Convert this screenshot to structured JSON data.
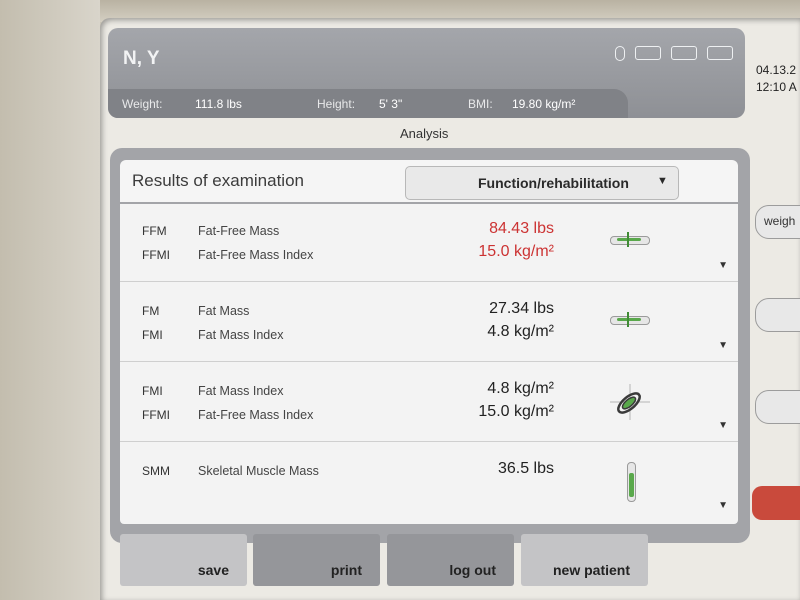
{
  "patient": {
    "name": "N, Y",
    "weight_label": "Weight:",
    "weight": "111.8 lbs",
    "height_label": "Height:",
    "height": "5' 3\"",
    "bmi_label": "BMI:",
    "bmi": "19.80 kg/m²"
  },
  "datetime": {
    "date": "04.13.2",
    "time": "12:10 A"
  },
  "tab_title": "Analysis",
  "panel": {
    "title": "Results of examination",
    "dropdown_selected": "Function/rehabilitation"
  },
  "results": [
    {
      "lines": [
        {
          "abbr": "FFM",
          "name": "Fat-Free Mass",
          "value": "84.43 lbs",
          "highlight": true
        },
        {
          "abbr": "FFMI",
          "name": "Fat-Free Mass Index",
          "value": "15.0 kg/m²",
          "highlight": true
        }
      ],
      "indicator": "horizontal-gauge-icon"
    },
    {
      "lines": [
        {
          "abbr": "FM",
          "name": "Fat Mass",
          "value": "27.34 lbs",
          "highlight": false
        },
        {
          "abbr": "FMI",
          "name": "Fat Mass Index",
          "value": "4.8 kg/m²",
          "highlight": false
        }
      ],
      "indicator": "horizontal-gauge-icon"
    },
    {
      "lines": [
        {
          "abbr": "FMI",
          "name": "Fat Mass Index",
          "value": "4.8 kg/m²",
          "highlight": false
        },
        {
          "abbr": "FFMI",
          "name": "Fat-Free Mass Index",
          "value": "15.0 kg/m²",
          "highlight": false
        }
      ],
      "indicator": "target-ellipse-icon"
    },
    {
      "lines": [
        {
          "abbr": "SMM",
          "name": "Skeletal Muscle Mass",
          "value": "36.5 lbs",
          "highlight": false
        }
      ],
      "indicator": "vertical-gauge-icon"
    }
  ],
  "buttons": {
    "save": "save",
    "print": "print",
    "logout": "log out",
    "new_patient": "new patient"
  },
  "side": {
    "weight_button": "weigh"
  },
  "colors": {
    "highlight": "#cc3333",
    "header": "#9a9ca1",
    "panel": "#a3a4a8",
    "gauge": "#59a84b",
    "alert": "#c94a3c"
  }
}
